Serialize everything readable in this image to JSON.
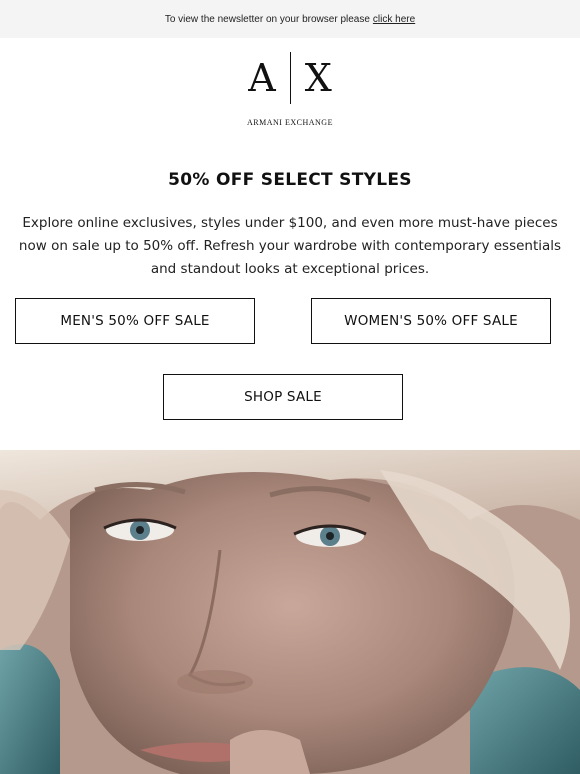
{
  "preheader": {
    "text": "To view the newsletter on your browser please",
    "link": "click here"
  },
  "logo": {
    "left_letter": "A",
    "right_letter": "X",
    "brand": "ARMANI EXCHANGE"
  },
  "headline": "50% OFF SELECT STYLES",
  "body": "Explore online exclusives, styles under $100, and even more must-have pieces now on sale up to 50% off. Refresh your wardrobe with contemporary essentials and standout looks at exceptional prices.",
  "buttons": {
    "men": "MEN'S 50% OFF SALE",
    "women": "WOMEN'S 50% OFF SALE",
    "shop": "SHOP SALE"
  },
  "hero": {
    "subject": "close-up portrait of a woman with blonde hair"
  }
}
